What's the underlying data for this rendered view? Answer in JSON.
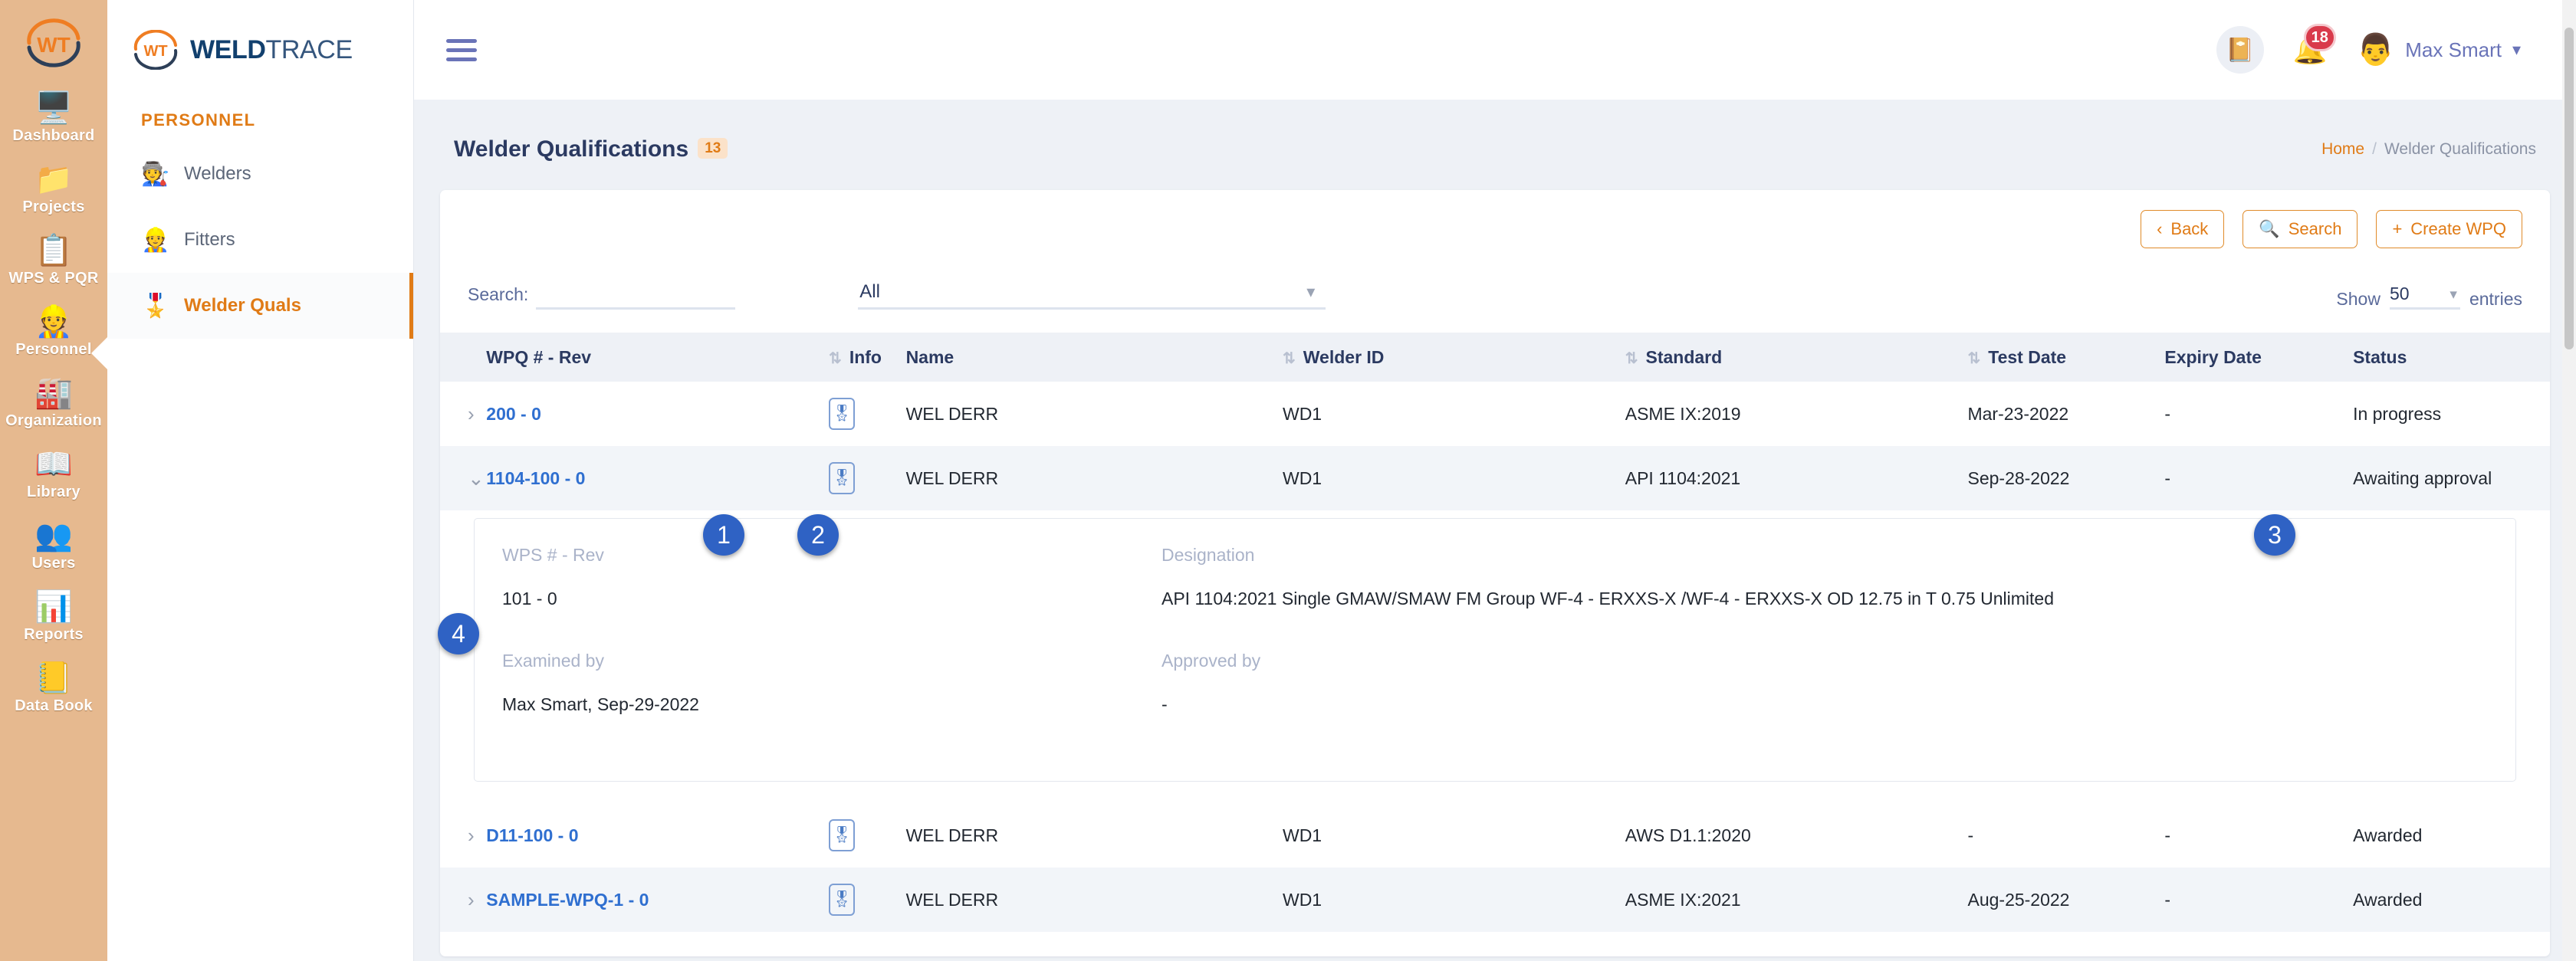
{
  "brand": {
    "mark_icon": "weldtrace-logo-icon",
    "name_bold": "WELD",
    "name_light": "TRACE"
  },
  "icon_rail": {
    "logo_icon": "weldtrace-rail-logo-icon",
    "items": [
      {
        "label": "Dashboard",
        "icon": "dashboard-icon",
        "glyph": "🖥️",
        "active": false
      },
      {
        "label": "Projects",
        "icon": "projects-icon",
        "glyph": "📁",
        "active": false
      },
      {
        "label": "WPS & PQR",
        "icon": "wps-pqr-icon",
        "glyph": "📋",
        "active": false
      },
      {
        "label": "Personnel",
        "icon": "personnel-icon",
        "glyph": "👷",
        "active": true
      },
      {
        "label": "Organization",
        "icon": "organization-icon",
        "glyph": "🏭",
        "active": false
      },
      {
        "label": "Library",
        "icon": "library-icon",
        "glyph": "📖",
        "active": false
      },
      {
        "label": "Users",
        "icon": "users-icon",
        "glyph": "👥",
        "active": false
      },
      {
        "label": "Reports",
        "icon": "reports-icon",
        "glyph": "📊",
        "active": false
      },
      {
        "label": "Data Book",
        "icon": "data-book-icon",
        "glyph": "📒",
        "active": false
      }
    ]
  },
  "submenu": {
    "title": "PERSONNEL",
    "items": [
      {
        "label": "Welders",
        "icon": "welder-icon",
        "glyph": "🧑‍🏭",
        "active": false
      },
      {
        "label": "Fitters",
        "icon": "fitter-icon",
        "glyph": "👷",
        "active": false
      },
      {
        "label": "Welder Quals",
        "icon": "certificate-icon",
        "glyph": "🎖️",
        "active": true
      }
    ]
  },
  "topbar": {
    "menu_toggle_icon": "hamburger-icon",
    "book_icon": "book-icon",
    "notifications_icon": "bell-icon",
    "notifications_count": "18",
    "avatar_icon": "avatar-icon",
    "user_name": "Max Smart",
    "user_caret_icon": "chevron-down-icon"
  },
  "page": {
    "title": "Welder Qualifications",
    "count": "13",
    "breadcrumb": {
      "home": "Home",
      "separator": "/",
      "current": "Welder Qualifications"
    }
  },
  "actions": {
    "back": {
      "label": "Back",
      "icon": "chevron-left-icon"
    },
    "search": {
      "label": "Search",
      "icon": "search-icon"
    },
    "create": {
      "label": "Create WPQ",
      "icon": "plus-icon"
    }
  },
  "filters": {
    "search_label": "Search:",
    "search_value": "",
    "search_placeholder": "",
    "category_value": "All",
    "category_options": [
      "All"
    ],
    "category_caret_icon": "chevron-down-icon",
    "show_label": "Show",
    "entries_value": "50",
    "entries_options": [
      "50"
    ],
    "entries_caret_icon": "chevron-down-icon",
    "entries_label": "entries"
  },
  "table": {
    "columns": [
      {
        "key": "chev",
        "label": "",
        "sortable": false
      },
      {
        "key": "wpq",
        "label": "WPQ # - Rev",
        "sortable": false
      },
      {
        "key": "info",
        "label": "Info",
        "sortable": true
      },
      {
        "key": "name",
        "label": "Name",
        "sortable": false
      },
      {
        "key": "wid",
        "label": "Welder ID",
        "sortable": true
      },
      {
        "key": "std",
        "label": "Standard",
        "sortable": true
      },
      {
        "key": "test",
        "label": "Test Date",
        "sortable": true
      },
      {
        "key": "exp",
        "label": "Expiry Date",
        "sortable": false
      },
      {
        "key": "status",
        "label": "Status",
        "sortable": false
      }
    ],
    "sort_icon": "sort-arrows-icon",
    "expand_icon": "chevron-right-icon",
    "collapse_icon": "chevron-down-icon",
    "info_icon": "certificate-badge-icon",
    "rows": [
      {
        "expanded": false,
        "shade": "plain",
        "wpq": "200 - 0",
        "name": "WEL DERR",
        "welder_id": "WD1",
        "standard": "ASME IX:2019",
        "test_date": "Mar-23-2022",
        "expiry_date": "-",
        "status": "In progress"
      },
      {
        "expanded": true,
        "shade": "alt",
        "wpq": "1104-100 - 0",
        "name": "WEL DERR",
        "welder_id": "WD1",
        "standard": "API 1104:2021",
        "test_date": "Sep-28-2022",
        "expiry_date": "-",
        "status": "Awaiting approval"
      },
      {
        "expanded": false,
        "shade": "plain",
        "wpq": "D11-100 - 0",
        "name": "WEL DERR",
        "welder_id": "WD1",
        "standard": "AWS D1.1:2020",
        "test_date": "-",
        "expiry_date": "-",
        "status": "Awarded"
      },
      {
        "expanded": false,
        "shade": "alt",
        "wpq": "SAMPLE-WPQ-1 - 0",
        "name": "WEL DERR",
        "welder_id": "WD1",
        "standard": "ASME IX:2021",
        "test_date": "Aug-25-2022",
        "expiry_date": "-",
        "status": "Awarded"
      }
    ]
  },
  "detail": {
    "wps_label": "WPS # - Rev",
    "wps_value": "101 - 0",
    "designation_label": "Designation",
    "designation_value": "API 1104:2021 Single GMAW/SMAW FM Group WF-4 - ERXXS-X /WF-4 - ERXXS-X OD 12.75 in T 0.75 Unlimited",
    "examined_label": "Examined by",
    "examined_value": "Max Smart, Sep-29-2022",
    "approved_label": "Approved by",
    "approved_value": "-"
  },
  "annotations": [
    {
      "id": "1",
      "text": "1"
    },
    {
      "id": "2",
      "text": "2"
    },
    {
      "id": "3",
      "text": "3"
    },
    {
      "id": "4",
      "text": "4"
    }
  ],
  "colors": {
    "accent_orange": "#e07b16",
    "rail_bg": "#e6b98f",
    "link_blue": "#2f6fd0",
    "badge_blue": "#2f62c4",
    "title_navy": "#2b3a61",
    "bell_red": "#d93a4b"
  }
}
